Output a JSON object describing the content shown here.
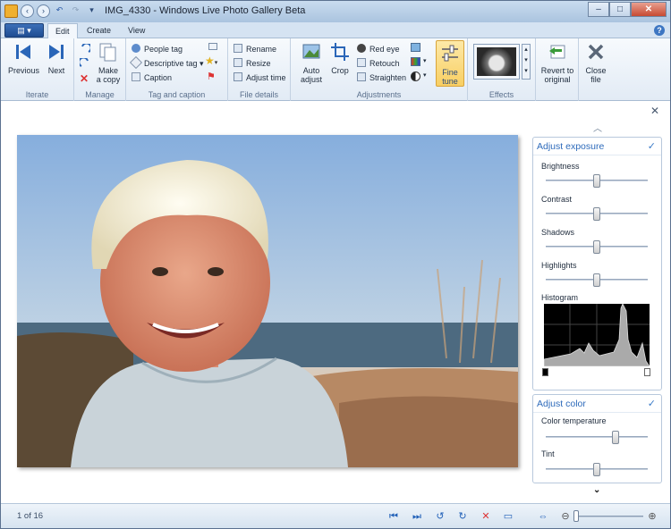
{
  "window": {
    "title": "IMG_4330 - Windows Live Photo Gallery Beta"
  },
  "quick_access": [
    "app-icon",
    "back-icon",
    "forward-icon",
    "undo-icon",
    "redo-icon",
    "dropdown-icon"
  ],
  "ribbon": {
    "tabs": [
      {
        "label": "Edit",
        "active": true
      },
      {
        "label": "Create",
        "active": false
      },
      {
        "label": "View",
        "active": false
      }
    ],
    "groups": {
      "iterate": {
        "label": "Iterate",
        "previous": "Previous",
        "next": "Next"
      },
      "manage": {
        "label": "Manage",
        "make_copy": "Make\na copy"
      },
      "tag_caption": {
        "label": "Tag and caption",
        "people_tag": "People tag",
        "descriptive_tag": "Descriptive tag",
        "caption": "Caption"
      },
      "file_details": {
        "label": "File details",
        "rename": "Rename",
        "resize": "Resize",
        "adjust_time": "Adjust time"
      },
      "adjustments": {
        "label": "Adjustments",
        "auto_adjust": "Auto\nadjust",
        "crop": "Crop",
        "red_eye": "Red eye",
        "retouch": "Retouch",
        "straighten": "Straighten",
        "fine_tune": "Fine\ntune"
      },
      "effects": {
        "label": "Effects"
      },
      "revert": {
        "label": "Revert to\noriginal"
      },
      "close": {
        "label": "Close\nfile"
      }
    }
  },
  "side_pane": {
    "adjust_exposure": {
      "title": "Adjust exposure",
      "sliders": [
        {
          "label": "Brightness",
          "value": 0.5
        },
        {
          "label": "Contrast",
          "value": 0.5
        },
        {
          "label": "Shadows",
          "value": 0.5
        },
        {
          "label": "Highlights",
          "value": 0.5
        }
      ],
      "histogram_label": "Histogram"
    },
    "adjust_color": {
      "title": "Adjust color",
      "sliders": [
        {
          "label": "Color temperature",
          "value": 0.68
        },
        {
          "label": "Tint",
          "value": 0.5
        }
      ]
    }
  },
  "status": {
    "position": "1 of 16"
  },
  "colors": {
    "accent": "#2e6bbb",
    "fine_tune_bg": "#f8cf63",
    "close_button": "#c74a32"
  }
}
